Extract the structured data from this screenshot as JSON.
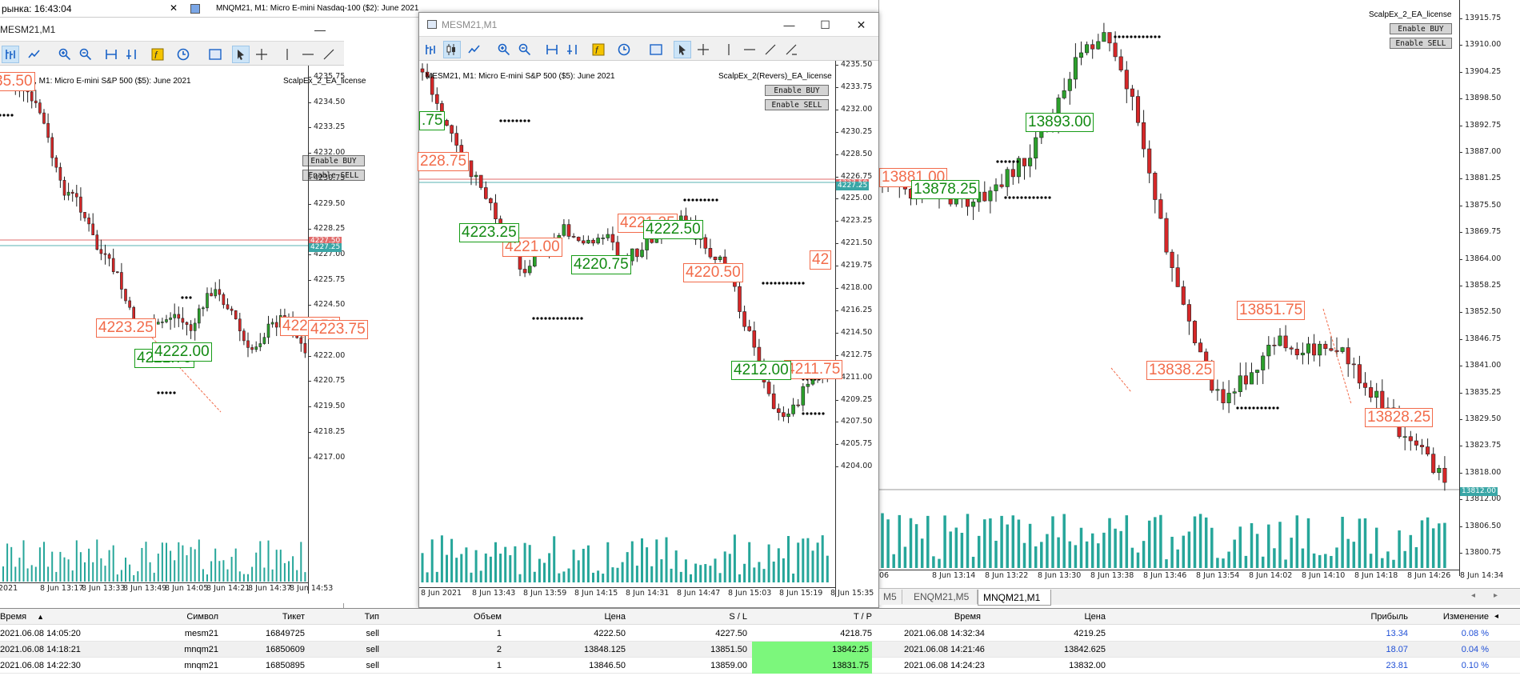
{
  "left_window": {
    "status_title": "рынка: 16:43:04",
    "title": "MESM21,M1",
    "chart_header": "MESM21, M1:  Micro E-mini S&P 500 ($5): June 2021",
    "ea_name": "ScalpEx_2_EA_license",
    "enable_buy": "Enable BUY",
    "enable_sell": "Enable SELL",
    "price_axis": [
      "4235.75",
      "4234.50",
      "4233.25",
      "4232.00",
      "4230.75",
      "4229.50",
      "4228.25",
      "4227.00",
      "4225.75",
      "4224.50",
      "4223.25",
      "4222.00",
      "4220.75",
      "4219.50",
      "4218.25",
      "4217.00"
    ],
    "price_tags": [
      "4227.50",
      "4227.25"
    ],
    "time_axis": [
      "2021",
      "8 Jun 13:17",
      "8 Jun 13:33",
      "8 Jun 13:49",
      "8 Jun 14:05",
      "8 Jun 14:21",
      "8 Jun 14:37",
      "8 Jun 14:53"
    ],
    "labels_red": [
      "35.50",
      "4223.25",
      "4223.50",
      "4223.75"
    ],
    "labels_green": [
      "4221.75",
      "4222.00"
    ]
  },
  "mid_window": {
    "title": "MESM21,M1",
    "chart_header": "MESM21, M1:  Micro E-mini S&P 500 ($5): June 2021",
    "ea_name": "ScalpEx_2(Revers)_EA_license",
    "enable_buy": "Enable BUY",
    "enable_sell": "Enable SELL",
    "price_axis": [
      "4235.50",
      "4233.75",
      "4232.00",
      "4230.25",
      "4228.50",
      "4226.75",
      "4225.00",
      "4223.25",
      "4221.50",
      "4219.75",
      "4218.00",
      "4216.25",
      "4214.50",
      "4212.75",
      "4211.00",
      "4209.25",
      "4207.50",
      "4205.75",
      "4204.00"
    ],
    "price_tags": [
      "4227.50",
      "4227.25"
    ],
    "time_axis": [
      "8 Jun 2021",
      "8 Jun 13:43",
      "8 Jun 13:59",
      "8 Jun 14:15",
      "8 Jun 14:31",
      "8 Jun 14:47",
      "8 Jun 15:03",
      "8 Jun 15:19",
      "8 Jun 15:35"
    ],
    "labels_red": [
      "228.75",
      "4221.00",
      "4221.25",
      "4220.50",
      "4211.75",
      "42"
    ],
    "labels_green": [
      ".75",
      "4223.25",
      "4220.75",
      "4222.50",
      "4212.00"
    ]
  },
  "right_chart": {
    "header": "MNQM21, M1:  Micro E-mini Nasdaq-100 ($2): June 2021",
    "ea_name": "ScalpEx_2_EA_license",
    "enable_buy": "Enable BUY",
    "enable_sell": "Enable SELL",
    "price_axis": [
      "13915.75",
      "13910.00",
      "13904.25",
      "13898.50",
      "13892.75",
      "13887.00",
      "13881.25",
      "13875.50",
      "13869.75",
      "13864.00",
      "13858.25",
      "13852.50",
      "13846.75",
      "13841.00",
      "13835.25",
      "13829.50",
      "13823.75",
      "13818.00",
      "13812.00",
      "13806.50",
      "13800.75"
    ],
    "current_price": "13812.00",
    "time_axis": [
      "06",
      "8 Jun 13:14",
      "8 Jun 13:22",
      "8 Jun 13:30",
      "8 Jun 13:38",
      "8 Jun 13:46",
      "8 Jun 13:54",
      "8 Jun 14:02",
      "8 Jun 14:10",
      "8 Jun 14:18",
      "8 Jun 14:26",
      "8 Jun 14:34"
    ],
    "labels_red": [
      "13881.00",
      "13851.75",
      "13838.25",
      "13828.25"
    ],
    "labels_green": [
      "13878.25",
      "13893.00"
    ]
  },
  "tabs": [
    "M5",
    "ENQM21,M5",
    "MNQM21,M1"
  ],
  "terminal": {
    "headers": [
      "Время",
      "Символ",
      "Тикет",
      "Тип",
      "Объем",
      "Цена",
      "S / L",
      "T / P",
      "Время",
      "Цена",
      "Прибыль",
      "Изменение"
    ],
    "rows": [
      [
        "2021.06.08 14:05:20",
        "mesm21",
        "16849725",
        "sell",
        "1",
        "4222.50",
        "4227.50",
        "4218.75",
        "2021.06.08 14:32:34",
        "4219.25",
        "13.34",
        "0.08 %"
      ],
      [
        "2021.06.08 14:18:21",
        "mnqm21",
        "16850609",
        "sell",
        "2",
        "13848.125",
        "13851.50",
        "13842.25",
        "2021.06.08 14:21:46",
        "13842.625",
        "18.07",
        "0.04 %"
      ],
      [
        "2021.06.08 14:22:30",
        "mnqm21",
        "16850895",
        "sell",
        "1",
        "13846.50",
        "13859.00",
        "13831.75",
        "2021.06.08 14:24:23",
        "13832.00",
        "23.81",
        "0.10 %"
      ]
    ]
  },
  "colors": {
    "bull": "#2ca02c",
    "bear": "#d62728",
    "volume": "#26a69a",
    "label_red": "#f26b4a",
    "label_green": "#179c17",
    "tp_fill": "#7cf77c",
    "profit": "#1f4fd6"
  }
}
